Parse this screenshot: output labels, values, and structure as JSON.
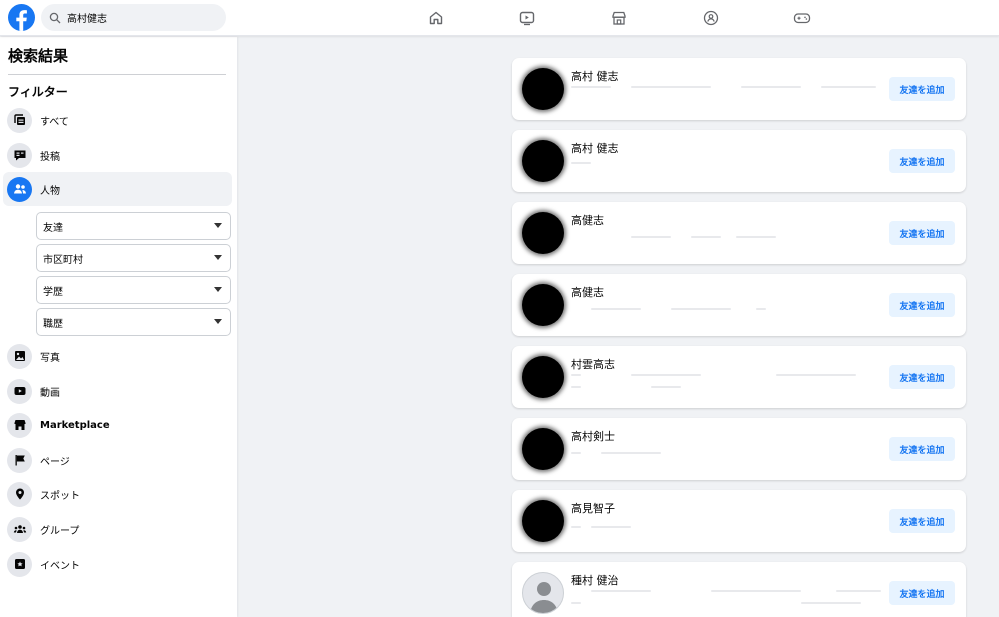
{
  "search": {
    "value": "高村健志"
  },
  "nav": [
    "home-icon",
    "watch-icon",
    "marketplace-icon",
    "groups-icon",
    "gaming-icon"
  ],
  "sidebar": {
    "title": "検索結果",
    "filter_heading": "フィルター",
    "items": [
      {
        "label": "すべて",
        "icon": "all-icon"
      },
      {
        "label": "投稿",
        "icon": "posts-icon"
      },
      {
        "label": "人物",
        "icon": "people-icon",
        "active": true
      },
      {
        "label": "写真",
        "icon": "photos-icon"
      },
      {
        "label": "動画",
        "icon": "videos-icon"
      },
      {
        "label": "Marketplace",
        "icon": "marketplace-icon"
      },
      {
        "label": "ページ",
        "icon": "pages-icon"
      },
      {
        "label": "スポット",
        "icon": "places-icon"
      },
      {
        "label": "グループ",
        "icon": "groups-icon"
      },
      {
        "label": "イベント",
        "icon": "events-icon"
      }
    ],
    "people_filters": [
      "友達",
      "市区町村",
      "学歴",
      "職歴"
    ]
  },
  "results": [
    {
      "name": "高村 健志",
      "button": "友達を追加"
    },
    {
      "name": "高村 健志",
      "button": "友達を追加"
    },
    {
      "name": "高健志",
      "button": "友達を追加"
    },
    {
      "name": "高健志",
      "button": "友達を追加"
    },
    {
      "name": "村雲高志",
      "button": "友達を追加"
    },
    {
      "name": "高村剣士",
      "button": "友達を追加"
    },
    {
      "name": "高見智子",
      "button": "友達を追加"
    },
    {
      "name": "種村 健治",
      "button": "友達を追加"
    }
  ],
  "colors": {
    "brand": "#1877f2",
    "button_bg": "#e7f3ff",
    "page_bg": "#f0f2f5"
  }
}
